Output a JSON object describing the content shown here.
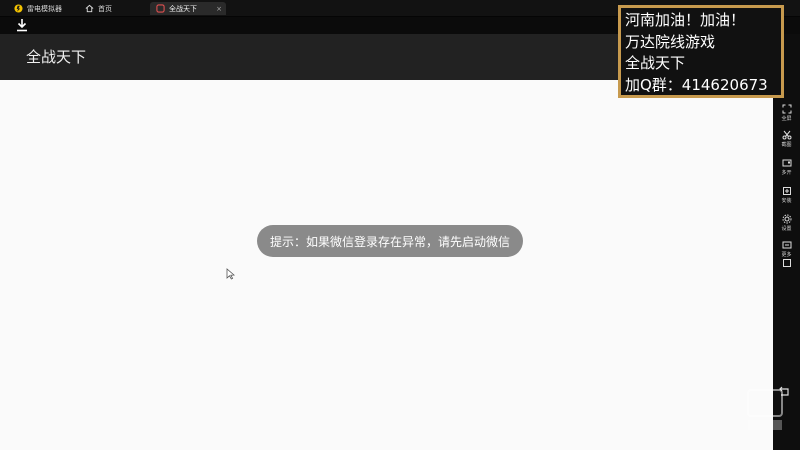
{
  "tabs": [
    {
      "label": "雷电模拟器",
      "icon": "emulator-logo-icon"
    },
    {
      "label": "首页",
      "icon": "home-icon"
    },
    {
      "label": "全战天下",
      "icon": "app-icon",
      "close": "×"
    }
  ],
  "toolbar": {
    "download_icon": "download-icon"
  },
  "app": {
    "title": "全战天下",
    "toast": "提示：如果微信登录存在异常，请先启动微信"
  },
  "sidebar": {
    "items": [
      {
        "label": "全屏",
        "icon": "fullscreen-icon"
      },
      {
        "label": "截图",
        "icon": "screenshot-icon"
      },
      {
        "label": "多开",
        "icon": "multi-instance-icon"
      },
      {
        "label": "安装",
        "icon": "install-icon"
      },
      {
        "label": "设置",
        "icon": "settings-icon"
      },
      {
        "label": "更多",
        "icon": "more-icon"
      }
    ]
  },
  "overlay": {
    "lines": [
      "河南加油！加油！",
      "万达院线游戏",
      "全战天下",
      "加Q群：414620673"
    ]
  },
  "colors": {
    "titlebar": "#222222",
    "content": "#fafafa",
    "toast_bg": "#8a8a8a",
    "overlay_border": "#c79a4e"
  }
}
